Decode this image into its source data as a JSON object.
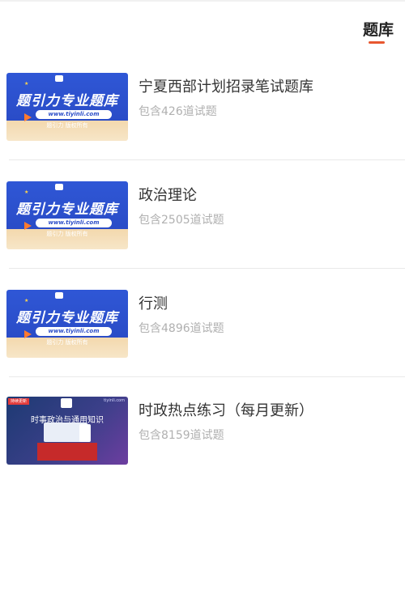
{
  "header": {
    "active_tab": "题库"
  },
  "items": [
    {
      "name": "宁夏西部计划招录笔试题库",
      "count": "包含426道试题",
      "thumb": {
        "style": "blue",
        "title": "题引力专业题库",
        "url": "www.tiyinli.com",
        "sub": "题引力 版权所有"
      }
    },
    {
      "name": "政治理论",
      "count": "包含2505道试题",
      "thumb": {
        "style": "blue",
        "title": "题引力专业题库",
        "url": "www.tiyinli.com",
        "sub": "题引力 版权所有"
      }
    },
    {
      "name": "行测",
      "count": "包含4896道试题",
      "thumb": {
        "style": "blue",
        "title": "题引力专业题库",
        "url": "www.tiyinli.com",
        "sub": "题引力 版权所有"
      }
    },
    {
      "name": "时政热点练习（每月更新）",
      "count": "包含8159道试题",
      "thumb": {
        "style": "dark",
        "badge": "持续更新",
        "site": "tiyinli.com",
        "title": "时事政治与通用知识"
      }
    }
  ]
}
